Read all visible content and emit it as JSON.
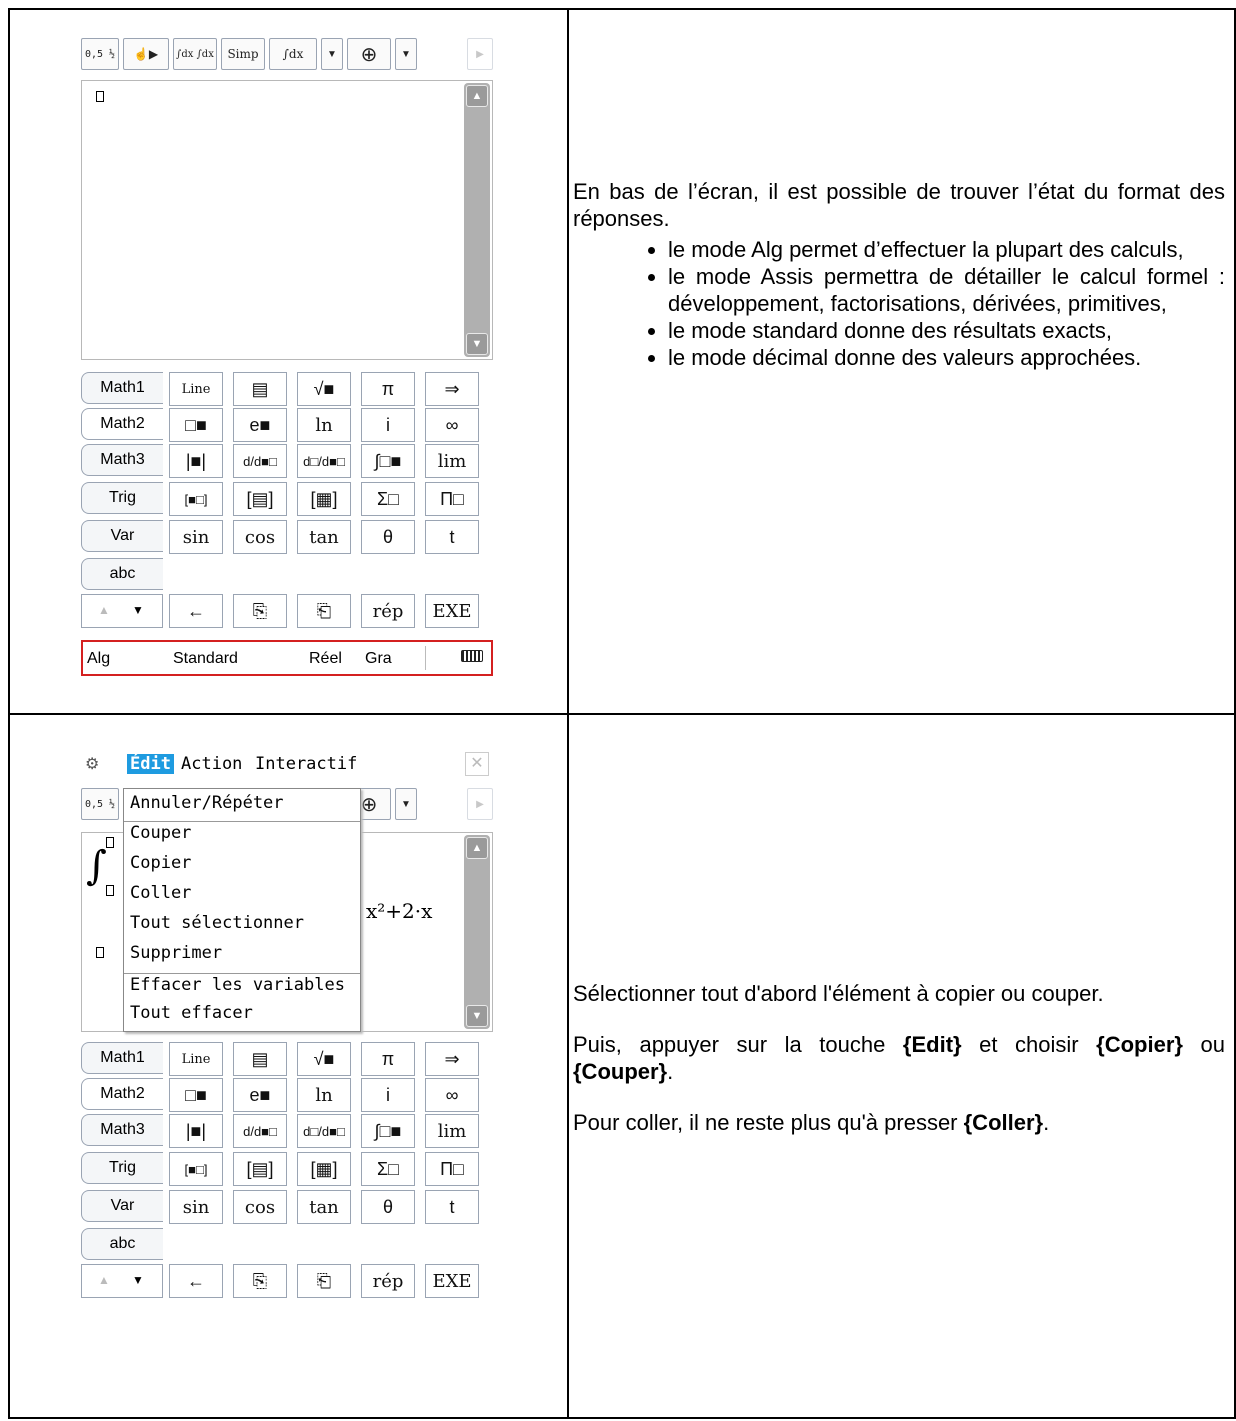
{
  "top_calculator": {
    "toolbar": [
      "0,5 ½",
      "☝▶",
      "∫dx ∫dx",
      "Simp",
      "∫dx",
      "▼",
      "⊕",
      "▼",
      "▶"
    ],
    "keypad": {
      "tabs": [
        "Math1",
        "Math2",
        "Math3",
        "Trig",
        "Var",
        "abc"
      ],
      "rows": [
        [
          "Line",
          "▤",
          "√■",
          "π",
          "⇒"
        ],
        [
          "□■",
          "e■",
          "ln",
          "i",
          "∞"
        ],
        [
          "|■|",
          "d/d■□",
          "d□/d■□",
          "∫□■",
          "lim"
        ],
        [
          "[■□]",
          "[▤]",
          "[▦]",
          "Σ□",
          "Π□"
        ],
        [
          "sin",
          "cos",
          "tan",
          "θ",
          "t"
        ],
        [
          "←",
          "⎘",
          "⎗",
          "rép",
          "EXE"
        ]
      ]
    },
    "status_bar": {
      "mode": "Alg",
      "format": "Standard",
      "domain": "Réel",
      "angle": "Gra",
      "battery_icon": "battery-icon"
    }
  },
  "top_text": {
    "intro": "En bas de l’écran, il est possible de trouver l’état du format des réponses.",
    "bullets": [
      "le mode Alg permet d’effectuer la plupart des calculs,",
      "le mode Assis permettra de détailler le calcul formel : développement, factorisations, dérivées, primitives,",
      "le mode standard donne des résultats exacts,",
      "le mode décimal donne des valeurs approchées."
    ]
  },
  "bottom_calculator": {
    "menu": [
      "Édit",
      "Action",
      "Interactif"
    ],
    "dropdown": [
      "Annuler/Répéter",
      "Couper",
      "Copier",
      "Coller",
      "Tout sélectionner",
      "Supprimer",
      "Effacer les variables",
      "Tout effacer"
    ],
    "expression": "x²+2·x"
  },
  "bottom_text": {
    "p1": "Sélectionner tout d'abord l'élément à copier ou couper.",
    "p2_a": "Puis, appuyer sur la touche ",
    "p2_b": "{Edit}",
    "p2_c": " et choisir ",
    "p2_d": "{Copier}",
    "p2_e": " ou ",
    "p2_f": "{Couper}",
    "p2_g": ".",
    "p3_a": "Pour coller, il ne reste plus qu'à presser ",
    "p3_b": "{Coller}",
    "p3_c": "."
  }
}
